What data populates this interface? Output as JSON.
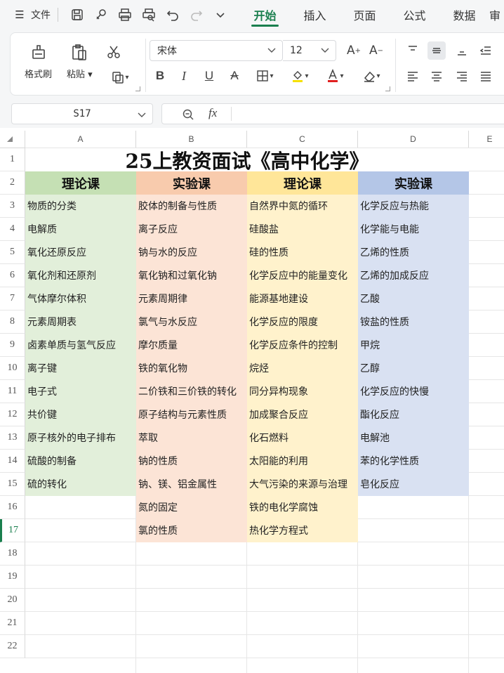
{
  "menubar": {
    "file_label": "文件",
    "tabs": [
      "开始",
      "插入",
      "页面",
      "公式",
      "数据",
      "审"
    ],
    "active_tab": "开始"
  },
  "ribbon": {
    "format_painter": "格式刷",
    "paste": "粘贴",
    "font_name": "宋体",
    "font_size": "12"
  },
  "formula_bar": {
    "cell_ref": "S17",
    "formula": ""
  },
  "sheet": {
    "columns": [
      "A",
      "B",
      "C",
      "D",
      "E"
    ],
    "rows": [
      "1",
      "2",
      "3",
      "4",
      "5",
      "6",
      "7",
      "8",
      "9",
      "10",
      "11",
      "12",
      "13",
      "14",
      "15",
      "16",
      "17",
      "18",
      "19",
      "20",
      "21",
      "22"
    ],
    "title": "25上教资面试《高中化学》",
    "headers": [
      "理论课",
      "实验课",
      "理论课",
      "实验课"
    ],
    "header_colors": [
      "#c5e0b4",
      "#f8cbad",
      "#ffe699",
      "#b4c6e7"
    ],
    "fill_colors": [
      "#e2efda",
      "#fce4d6",
      "#fff2cc",
      "#d9e1f2"
    ],
    "col_a": [
      "物质的分类",
      "电解质",
      "氧化还原反应",
      "氧化剂和还原剂",
      "气体摩尔体积",
      "元素周期表",
      "卤素单质与氢气反应",
      "离子键",
      "电子式",
      "共价键",
      "原子核外的电子排布",
      "硫酸的制备",
      "硫的转化"
    ],
    "col_b": [
      "胶体的制备与性质",
      "离子反应",
      "钠与水的反应",
      "氧化钠和过氧化钠",
      "元素周期律",
      "氯气与水反应",
      "摩尔质量",
      "铁的氧化物",
      "二价铁和三价铁的转化",
      "原子结构与元素性质",
      "萃取",
      "钠的性质",
      "钠、镁、铝金属性",
      "氮的固定",
      "氯的性质"
    ],
    "col_c": [
      "自然界中氮的循环",
      "硅酸盐",
      "硅的性质",
      "化学反应中的能量变化",
      "能源基地建设",
      "化学反应的限度",
      "化学反应条件的控制",
      "烷烃",
      "同分异构现象",
      "加成聚合反应",
      "化石燃料",
      "太阳能的利用",
      "大气污染的来源与治理",
      "铁的电化学腐蚀",
      "热化学方程式"
    ],
    "col_d": [
      "化学反应与热能",
      "化学能与电能",
      "乙烯的性质",
      "乙烯的加成反应",
      "乙酸",
      "铵盐的性质",
      "甲烷",
      "乙醇",
      "化学反应的快慢",
      "酯化反应",
      "电解池",
      "苯的化学性质",
      "皂化反应"
    ]
  }
}
